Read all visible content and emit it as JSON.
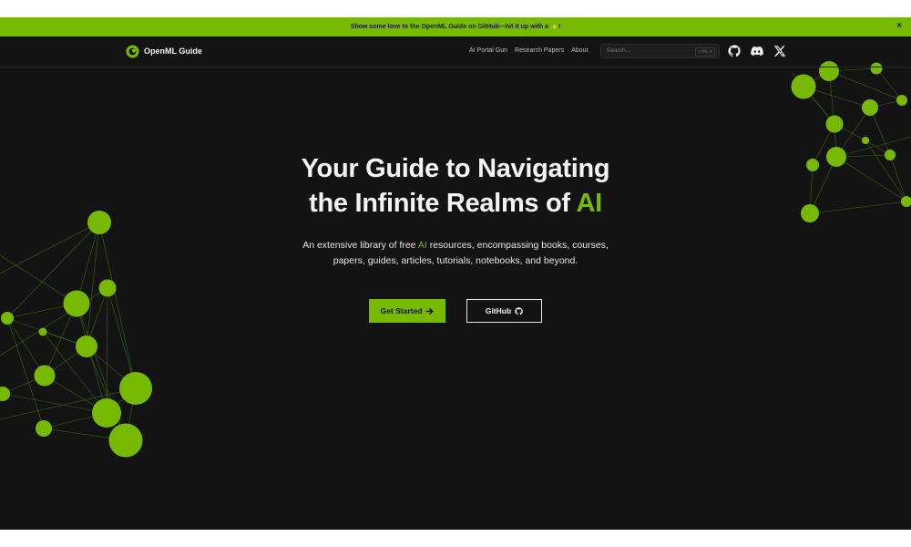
{
  "banner": {
    "text": "Show some love to the OpenML Guide on GitHub—hit it up with a",
    "tail": "!",
    "close": "×"
  },
  "nav": {
    "brand": "OpenML Guide",
    "links": [
      "AI Portal Gun",
      "Research Papers",
      "About"
    ],
    "search_placeholder": "Search...",
    "shortcut": "CTRL K"
  },
  "hero": {
    "title_line1": "Your Guide to Navigating",
    "title_line2_prefix": "the Infinite Realms of ",
    "title_line2_accent": "AI",
    "subtitle_prefix": "An extensive library of free ",
    "subtitle_accent": "AI",
    "subtitle_rest": " resources, encompassing books, courses,",
    "subtitle_line2": "papers, guides, articles, tutorials, notebooks, and beyond."
  },
  "buttons": {
    "primary": "Get Started",
    "secondary": "GitHub"
  },
  "colors": {
    "accent": "#76b900",
    "background": "#131313"
  },
  "icons": [
    "logo-icon",
    "github-icon",
    "discord-icon",
    "x-icon",
    "arrow-right-icon",
    "star-icon",
    "close-icon"
  ]
}
